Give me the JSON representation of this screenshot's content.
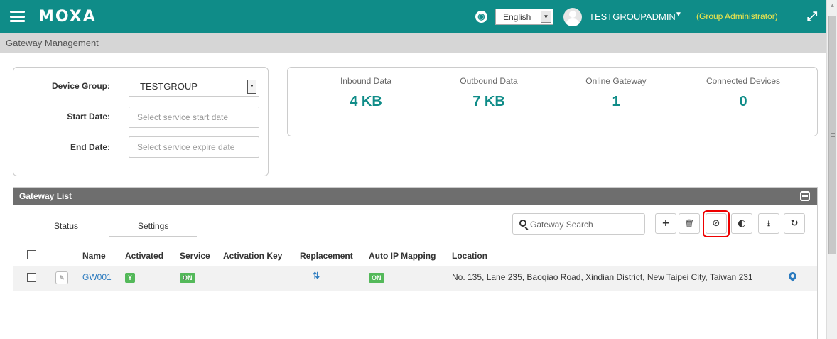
{
  "topbar": {
    "brand": "MOXA",
    "language": "English",
    "user_name": "TESTGROUPADMIN",
    "user_role": "(Group Administrator)",
    "icons": [
      "menu-icon",
      "globe-icon",
      "user-avatar",
      "caret-down-icon",
      "expand-icon"
    ],
    "colors": {
      "header": "#0f8c88",
      "role": "#f6e84a"
    }
  },
  "breadcrumb": "Gateway Management",
  "filters": {
    "device_group_label": "Device Group:",
    "device_group_value": "TESTGROUP",
    "start_date_label": "Start Date:",
    "start_date_placeholder": "Select service start date",
    "end_date_label": "End Date:",
    "end_date_placeholder": "Select service expire date"
  },
  "stats": [
    {
      "label": "Inbound Data",
      "value": "4 KB"
    },
    {
      "label": "Outbound Data",
      "value": "7 KB"
    },
    {
      "label": "Online Gateway",
      "value": "1"
    },
    {
      "label": "Connected Devices",
      "value": "0"
    }
  ],
  "gateway_list": {
    "title": "Gateway List",
    "tabs": [
      "Status",
      "Settings"
    ],
    "search_placeholder": "Gateway Search",
    "toolbar": [
      "add-icon",
      "delete-icon",
      "disable-icon",
      "toggle-icon",
      "download-icon",
      "refresh-icon"
    ],
    "columns": [
      "Name",
      "Activated",
      "Service",
      "Activation Key",
      "Replacement",
      "Auto IP Mapping",
      "Location"
    ],
    "rows": [
      {
        "name": "GW001",
        "activated": "Y",
        "service": "ON",
        "auto_ip_mapping": "ON",
        "location": "No. 135, Lane 235, Baoqiao Road, Xindian District, New Taipei City, Taiwan 231"
      }
    ]
  }
}
